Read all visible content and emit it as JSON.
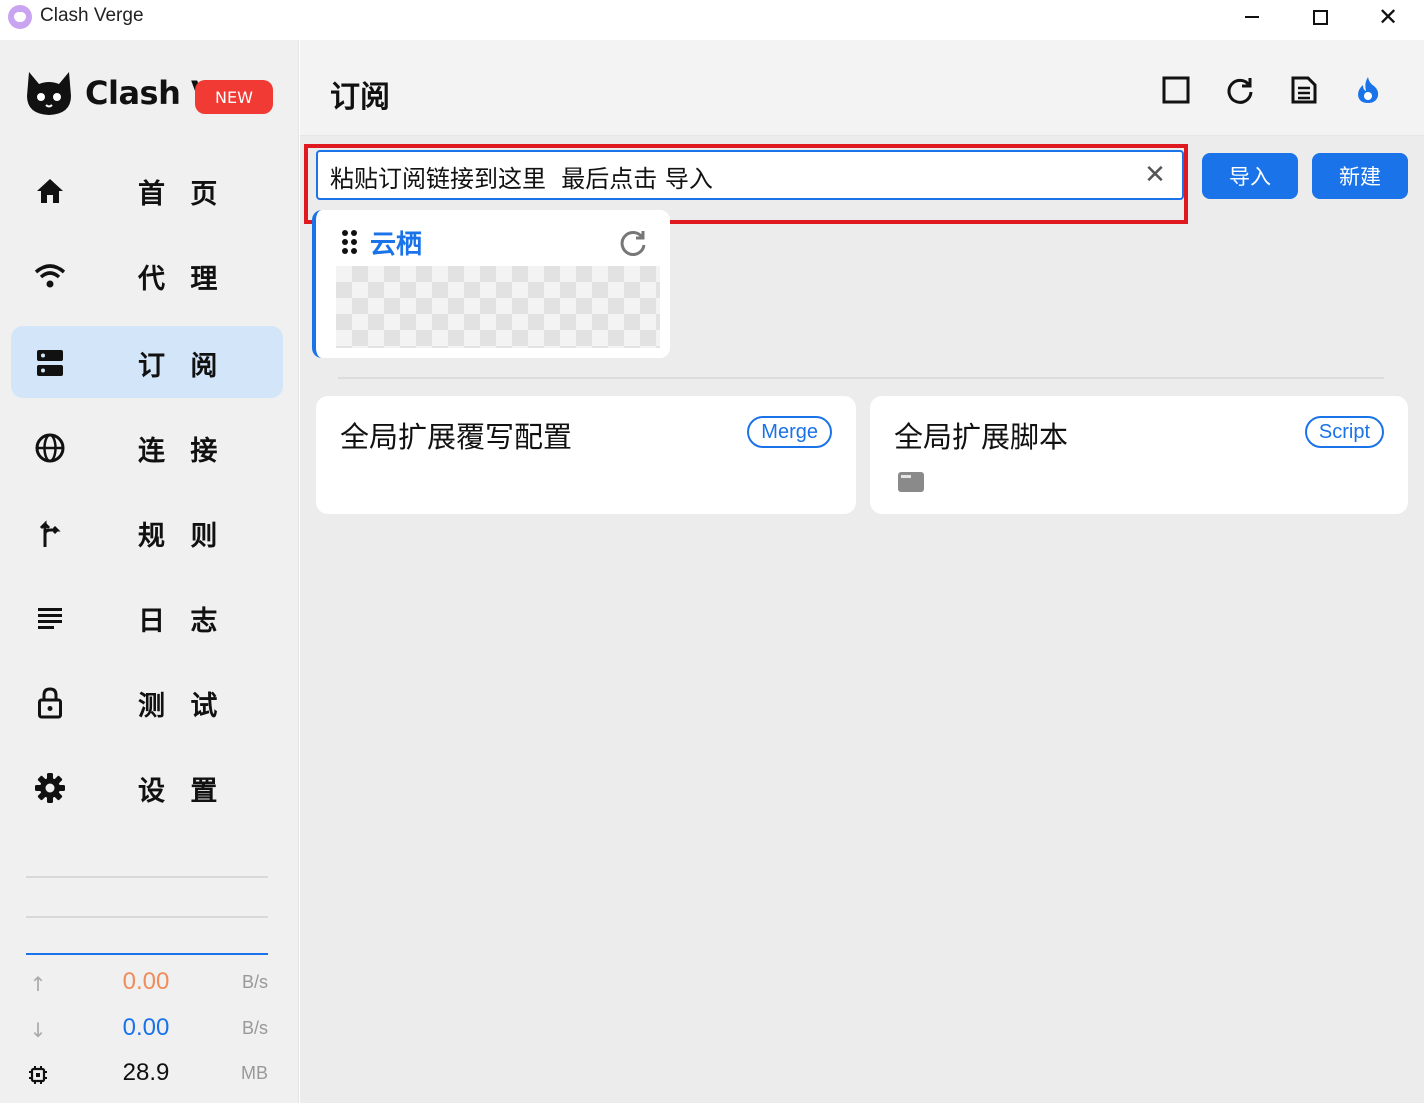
{
  "window": {
    "title": "Clash Verge",
    "controls": {
      "minimize": "minimize-icon",
      "maximize": "maximize-icon",
      "close": "close-icon"
    }
  },
  "sidebar": {
    "logo": {
      "text": "Clash V",
      "badge": "NEW"
    },
    "items": [
      {
        "label": "首 页",
        "icon": "home-icon",
        "active": false
      },
      {
        "label": "代 理",
        "icon": "wifi-icon",
        "active": false
      },
      {
        "label": "订 阅",
        "icon": "dns-icon",
        "active": true
      },
      {
        "label": "连 接",
        "icon": "globe-icon",
        "active": false
      },
      {
        "label": "规 则",
        "icon": "fork-icon",
        "active": false
      },
      {
        "label": "日 志",
        "icon": "list-icon",
        "active": false
      },
      {
        "label": "测 试",
        "icon": "lock-icon",
        "active": false
      },
      {
        "label": "设 置",
        "icon": "gear-icon",
        "active": false
      }
    ],
    "traffic": {
      "upload": {
        "value": "0.00",
        "unit": "B/s",
        "color": "#f08c5a"
      },
      "download": {
        "value": "0.00",
        "unit": "B/s",
        "color": "#1a73e8"
      },
      "memory": {
        "value": "28.9",
        "unit": "MB",
        "color": "#111111"
      }
    }
  },
  "main": {
    "title": "订阅",
    "header_icons": [
      "square-icon",
      "refresh-icon",
      "document-icon",
      "fire-icon"
    ],
    "url_input": {
      "value": "粘贴订阅链接到这里  最后点击 导入",
      "placeholder": ""
    },
    "buttons": {
      "import": "导入",
      "new": "新建"
    },
    "profile": {
      "name": "云栖"
    },
    "extensions": [
      {
        "title": "全局扩展覆写配置",
        "tag": "Merge"
      },
      {
        "title": "全局扩展脚本",
        "tag": "Script"
      }
    ]
  },
  "colors": {
    "accent": "#1a73e8",
    "highlight": "#e0181f",
    "badge": "#f03a33"
  }
}
